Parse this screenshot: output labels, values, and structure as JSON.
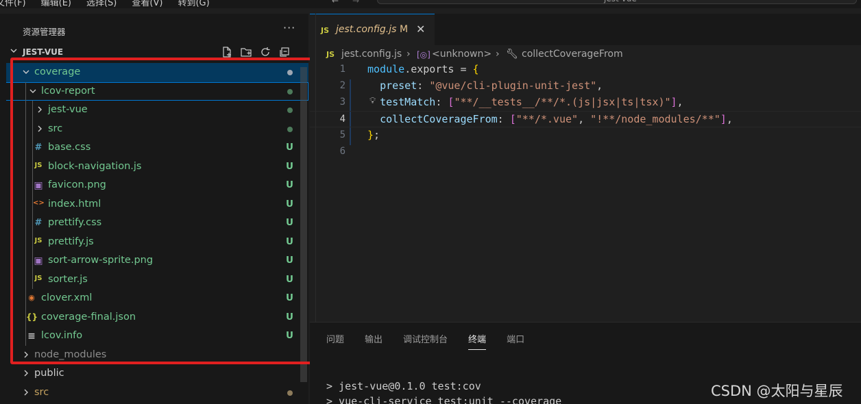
{
  "menubar": {
    "items": [
      "文件(F)",
      "编辑(E)",
      "选择(S)",
      "查看(V)",
      "转到(G)"
    ],
    "search_text": "jest-vue"
  },
  "explorer": {
    "title": "资源管理器",
    "more": "···",
    "project": "JEST-VUE",
    "tree": [
      {
        "label": "coverage",
        "indent": 0,
        "kind": "folder-open",
        "marker": "dot",
        "selected": true
      },
      {
        "label": "lcov-report",
        "indent": 1,
        "kind": "folder-open",
        "marker": "dot",
        "focus": true
      },
      {
        "label": "jest-vue",
        "indent": 2,
        "kind": "folder",
        "marker": "dot"
      },
      {
        "label": "src",
        "indent": 2,
        "kind": "folder",
        "marker": "dot"
      },
      {
        "label": "base.css",
        "indent": 2,
        "kind": "css",
        "icon": "#",
        "status": "U"
      },
      {
        "label": "block-navigation.js",
        "indent": 2,
        "kind": "js",
        "icon": "JS",
        "status": "U"
      },
      {
        "label": "favicon.png",
        "indent": 2,
        "kind": "image",
        "status": "U"
      },
      {
        "label": "index.html",
        "indent": 2,
        "kind": "html",
        "icon": "<>",
        "status": "U"
      },
      {
        "label": "prettify.css",
        "indent": 2,
        "kind": "css",
        "icon": "#",
        "status": "U"
      },
      {
        "label": "prettify.js",
        "indent": 2,
        "kind": "js",
        "icon": "JS",
        "status": "U"
      },
      {
        "label": "sort-arrow-sprite.png",
        "indent": 2,
        "kind": "image",
        "status": "U"
      },
      {
        "label": "sorter.js",
        "indent": 2,
        "kind": "js",
        "icon": "JS",
        "status": "U"
      },
      {
        "label": "clover.xml",
        "indent": 1,
        "kind": "rss",
        "status": "U"
      },
      {
        "label": "coverage-final.json",
        "indent": 1,
        "kind": "json",
        "icon": "{}",
        "status": "U"
      },
      {
        "label": "lcov.info",
        "indent": 1,
        "kind": "info",
        "status": "U"
      },
      {
        "label": "node_modules",
        "indent": 0,
        "kind": "folder",
        "muted": true
      },
      {
        "label": "public",
        "indent": 0,
        "kind": "folder"
      },
      {
        "label": "src",
        "indent": 0,
        "kind": "folder",
        "marker": "dot-olive"
      }
    ]
  },
  "editor": {
    "tab": {
      "icon": "JS",
      "name": "jest.config.js",
      "modified": "M",
      "close": "✕"
    },
    "breadcrumb": {
      "icon": "JS",
      "file": "jest.config.js",
      "sym1": "<unknown>",
      "sym2": "collectCoverageFrom"
    },
    "line_numbers": [
      "1",
      "2",
      "3",
      "4",
      "5",
      "6"
    ],
    "code": {
      "l1_obj": "module",
      "l1_rest": ".exports = ",
      "l1_brace": "{",
      "l2_key": "preset",
      "l2_val": "\"@vue/cli-plugin-unit-jest\"",
      "l3_key": "testMatch",
      "l3_val": "\"**/__tests__/**/*.(js|jsx|ts|tsx)\"",
      "l4_key": "collectCoverageFrom",
      "l4_val1": "\"**/*.vue\"",
      "l4_val2": "\"!**/node_modules/**\"",
      "l5_brace": "}",
      "colon": ": ",
      "comma": ",",
      "open_br": "[",
      "close_br": "]",
      "sep": ", ",
      "semi": ";"
    }
  },
  "panel": {
    "tabs": [
      "问题",
      "输出",
      "调试控制台",
      "终端",
      "端口"
    ],
    "active_tab": "终端",
    "terminal_lines": [
      "> jest-vue@0.1.0 test:cov",
      "> vue-cli-service test:unit --coverage"
    ]
  },
  "watermark": "CSDN @太阳与星辰",
  "colors": {
    "untracked": "#73c991",
    "selection": "#04395e",
    "highlight_box": "#e02020"
  }
}
